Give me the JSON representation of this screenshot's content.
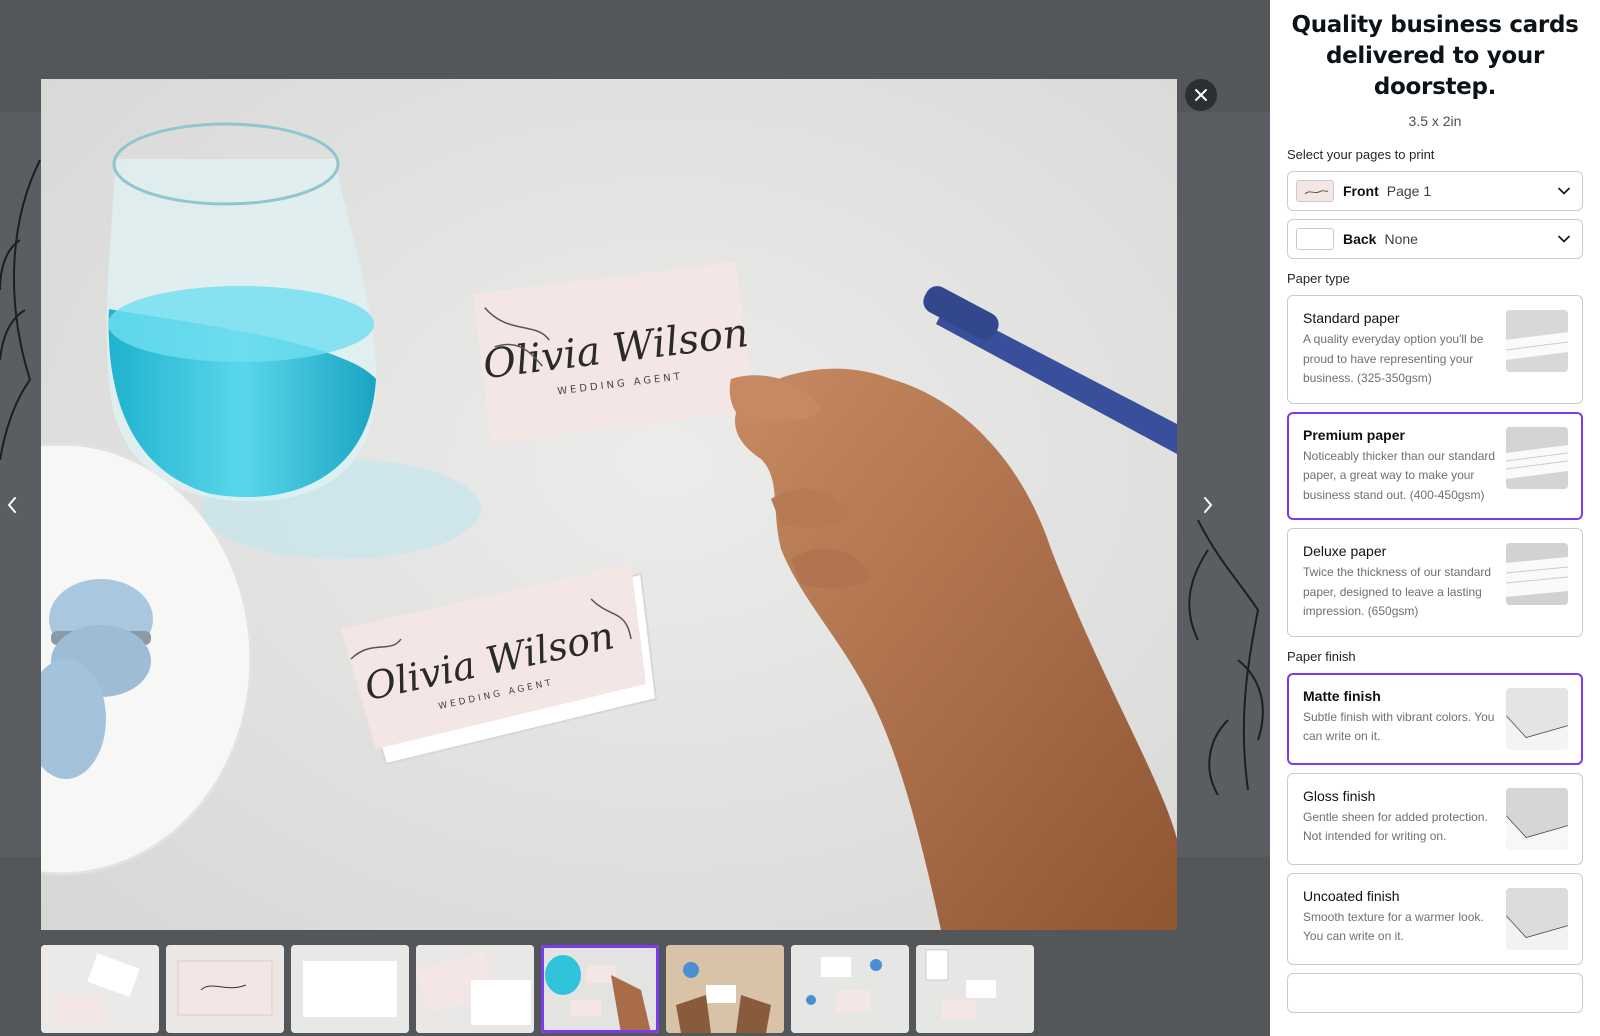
{
  "gallery": {
    "main_image": {
      "card_name": "Olivia Wilson",
      "card_title": "WEDDING AGENT"
    },
    "close_icon": "close-icon",
    "prev_icon": "chevron-left-icon",
    "next_icon": "chevron-right-icon",
    "thumbnails": [
      {
        "name": "thumb-1",
        "active": false
      },
      {
        "name": "thumb-2",
        "active": false
      },
      {
        "name": "thumb-3",
        "active": false
      },
      {
        "name": "thumb-4",
        "active": false
      },
      {
        "name": "thumb-5",
        "active": true
      },
      {
        "name": "thumb-6",
        "active": false
      },
      {
        "name": "thumb-7",
        "active": false
      },
      {
        "name": "thumb-8",
        "active": false
      }
    ]
  },
  "panel": {
    "headline": "Quality business cards delivered to your doorstep.",
    "size": "3.5 x 2in",
    "pages_label": "Select your pages to print",
    "front": {
      "side": "Front",
      "page": "Page 1"
    },
    "back": {
      "side": "Back",
      "page": "None"
    },
    "paper_type_label": "Paper type",
    "paper_types": [
      {
        "title": "Standard paper",
        "desc": "A quality everyday option you'll be proud to have representing your business. (325-350gsm)",
        "selected": false
      },
      {
        "title": "Premium paper",
        "desc": "Noticeably thicker than our standard paper, a great way to make your business stand out. (400-450gsm)",
        "selected": true
      },
      {
        "title": "Deluxe paper",
        "desc": "Twice the thickness of our standard paper, designed to leave a lasting impression. (650gsm)",
        "selected": false
      }
    ],
    "paper_finish_label": "Paper finish",
    "paper_finishes": [
      {
        "title": "Matte finish",
        "desc": "Subtle finish with vibrant colors. You can write on it.",
        "selected": true
      },
      {
        "title": "Gloss finish",
        "desc": "Gentle sheen for added protection. Not intended for writing on.",
        "selected": false
      },
      {
        "title": "Uncoated finish",
        "desc": "Smooth texture for a warmer look. You can write on it.",
        "selected": false
      }
    ]
  },
  "colors": {
    "accent": "#7c3aed",
    "backdrop": "#53575a",
    "card_pink": "#f4e6e4",
    "glass_blue": "#2fc4dc",
    "pen_blue": "#3a4f9c",
    "macaron_blue": "#a9c8e0"
  }
}
